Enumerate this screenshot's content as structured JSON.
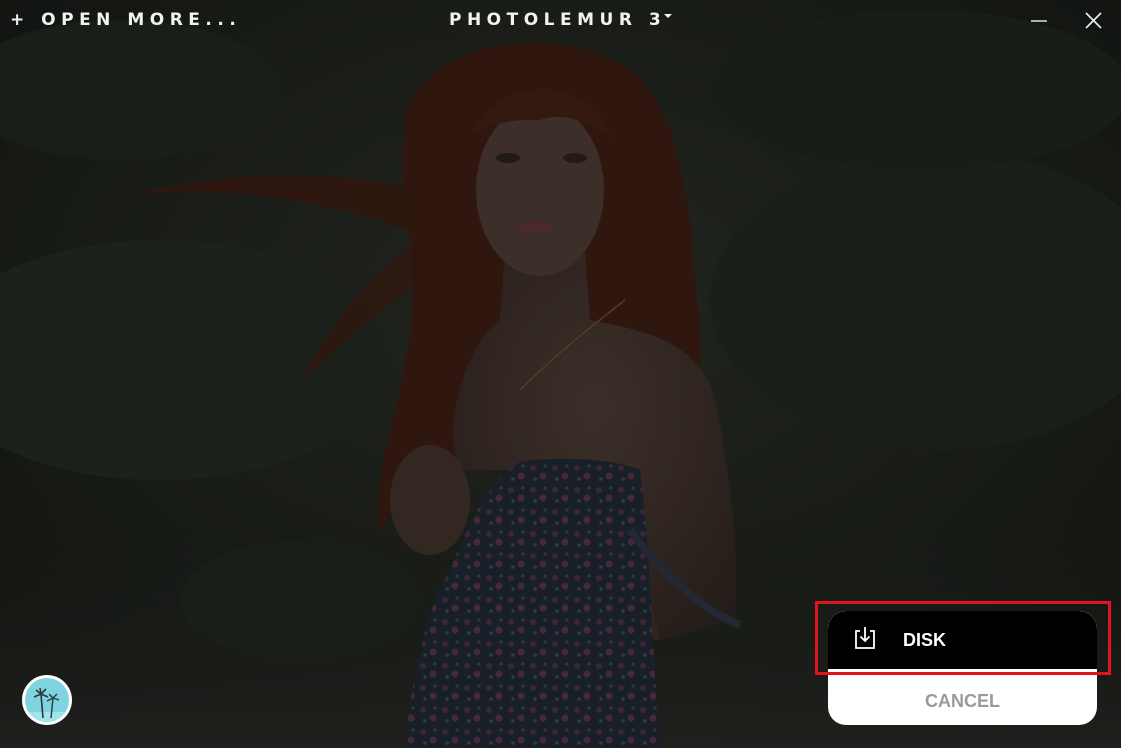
{
  "topbar": {
    "open_more_label": "+ OPEN MORE...",
    "app_title": "PHOTOLEMUR 3",
    "title_menu_icon": "caret-down-icon",
    "minimize_icon": "minimize-icon",
    "close_icon": "close-icon"
  },
  "photo": {
    "description_icon": "portrait-photo"
  },
  "avatar": {
    "icon": "palm-trees-avatar"
  },
  "export_menu": {
    "disk_label": "DISK",
    "disk_icon": "save-to-disk-icon",
    "cancel_label": "CANCEL"
  },
  "colors": {
    "menu_dark": "#000000",
    "menu_light": "#ffffff",
    "cancel_text": "#9a9a9a",
    "highlight": "#e0141e",
    "avatar_sky": "#7fd4e0"
  }
}
